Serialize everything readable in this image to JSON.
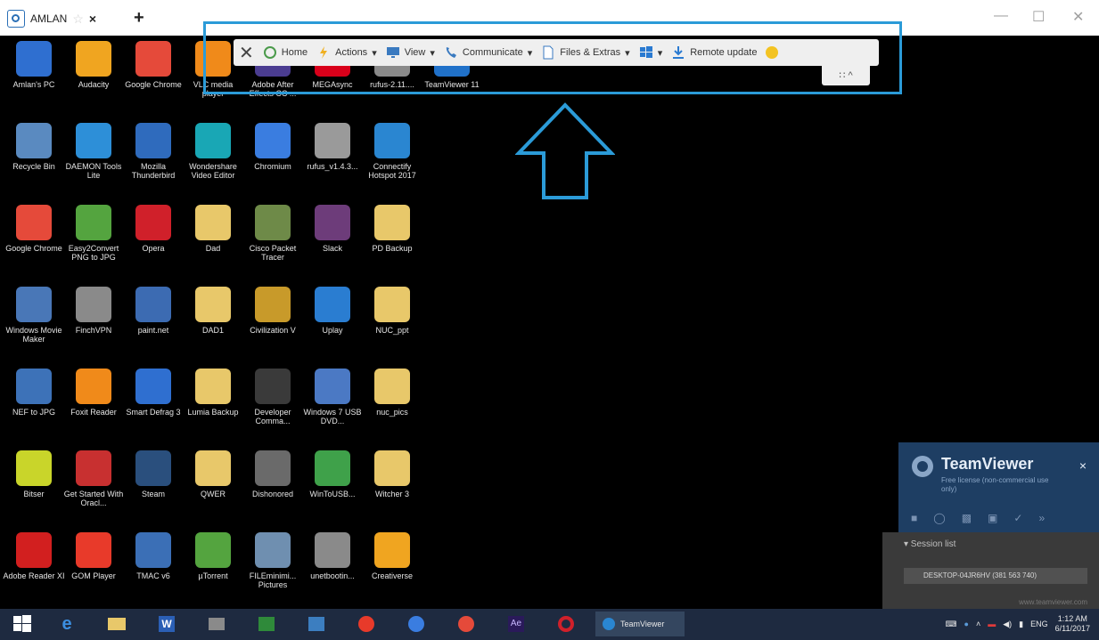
{
  "window": {
    "tab_label": "AMLAN",
    "tab_star": "☆",
    "tab_close": "×",
    "new_tab": "+",
    "minimize": "—",
    "maximize": "☐",
    "close": "✕"
  },
  "toolbar": {
    "close": "✕",
    "home": "Home",
    "actions": "Actions",
    "view": "View",
    "communicate": "Communicate",
    "files": "Files & Extras",
    "windows_caret": "▾",
    "remote_update": "Remote update",
    "collapse": "∷ ^"
  },
  "desktop_icons": [
    {
      "label": "Amlan's PC",
      "color": "#2f6fd0"
    },
    {
      "label": "Audacity",
      "color": "#f0a520"
    },
    {
      "label": "Google Chrome",
      "color": "#e54a3a"
    },
    {
      "label": "VLC media player",
      "color": "#f08a1a"
    },
    {
      "label": "Adobe After Effects CC ...",
      "color": "#4b3d91"
    },
    {
      "label": "MEGAsync",
      "color": "#d9001a"
    },
    {
      "label": "rufus-2.11....",
      "color": "#8a8a8a"
    },
    {
      "label": "TeamViewer 11",
      "color": "#2071c9"
    },
    {
      "label": "Recycle Bin",
      "color": "#5a8ac0"
    },
    {
      "label": "DAEMON Tools Lite",
      "color": "#2d8fd8"
    },
    {
      "label": "Mozilla Thunderbird",
      "color": "#2f6bbd"
    },
    {
      "label": "Wondershare Video Editor",
      "color": "#19a7b5"
    },
    {
      "label": "Chromium",
      "color": "#3a7de0"
    },
    {
      "label": "rufus_v1.4.3...",
      "color": "#9a9a9a"
    },
    {
      "label": "Connectify Hotspot 2017",
      "color": "#2a86d1"
    },
    {
      "label": "Google Chrome",
      "color": "#e54a3a"
    },
    {
      "label": "Easy2Convert PNG to JPG",
      "color": "#54a43f"
    },
    {
      "label": "Opera",
      "color": "#d0202a"
    },
    {
      "label": "Dad",
      "color": "#e8c86a"
    },
    {
      "label": "Cisco Packet Tracer",
      "color": "#6e8a48"
    },
    {
      "label": "Slack",
      "color": "#6d3c7a"
    },
    {
      "label": "PD Backup",
      "color": "#e8c86a"
    },
    {
      "label": "Windows Movie Maker",
      "color": "#4977b7"
    },
    {
      "label": "FinchVPN",
      "color": "#8a8a8a"
    },
    {
      "label": "paint.net",
      "color": "#3c6bb2"
    },
    {
      "label": "DAD1",
      "color": "#e8c86a"
    },
    {
      "label": "Civilization V",
      "color": "#c89a2a"
    },
    {
      "label": "Uplay",
      "color": "#2a7dd1"
    },
    {
      "label": "NUC_ppt",
      "color": "#e8c86a"
    },
    {
      "label": "NEF to JPG",
      "color": "#3d72b8"
    },
    {
      "label": "Foxit Reader",
      "color": "#f08a1a"
    },
    {
      "label": "Smart Defrag 3",
      "color": "#2f6fd0"
    },
    {
      "label": "Lumia Backup",
      "color": "#e8c86a"
    },
    {
      "label": "Developer Comma...",
      "color": "#3a3a3a"
    },
    {
      "label": "Windows 7 USB DVD...",
      "color": "#4b79c4"
    },
    {
      "label": "nuc_pics",
      "color": "#e8c86a"
    },
    {
      "label": "Bitser",
      "color": "#c9d52a"
    },
    {
      "label": "Get Started With Oracl...",
      "color": "#c83030"
    },
    {
      "label": "Steam",
      "color": "#2a4f7d"
    },
    {
      "label": "QWER",
      "color": "#e8c86a"
    },
    {
      "label": "Dishonored",
      "color": "#6a6a6a"
    },
    {
      "label": "WinToUSB...",
      "color": "#3fa14a"
    },
    {
      "label": "Witcher 3",
      "color": "#e8c86a"
    },
    {
      "label": "Adobe Reader XI",
      "color": "#d21f1f"
    },
    {
      "label": "GOM Player",
      "color": "#e83a2a"
    },
    {
      "label": "TMAC v6",
      "color": "#3b6fb6"
    },
    {
      "label": "µTorrent",
      "color": "#54a43f"
    },
    {
      "label": "FILEminimi... Pictures",
      "color": "#6f8fb0"
    },
    {
      "label": "unetbootin...",
      "color": "#8a8a8a"
    },
    {
      "label": "Creativerse",
      "color": "#f0a520"
    }
  ],
  "tv_panel": {
    "title": "TeamViewer",
    "subtitle": "Free license (non-commercial use only)",
    "close": "×"
  },
  "session": {
    "header": "▾ Session list",
    "item": "DESKTOP-04JR6HV (381 563 740)",
    "footer": "www.teamviewer.com"
  },
  "taskbar": {
    "tv_label": "TeamViewer",
    "lang": "ENG",
    "time": "1:12 AM",
    "date": "6/11/2017"
  }
}
